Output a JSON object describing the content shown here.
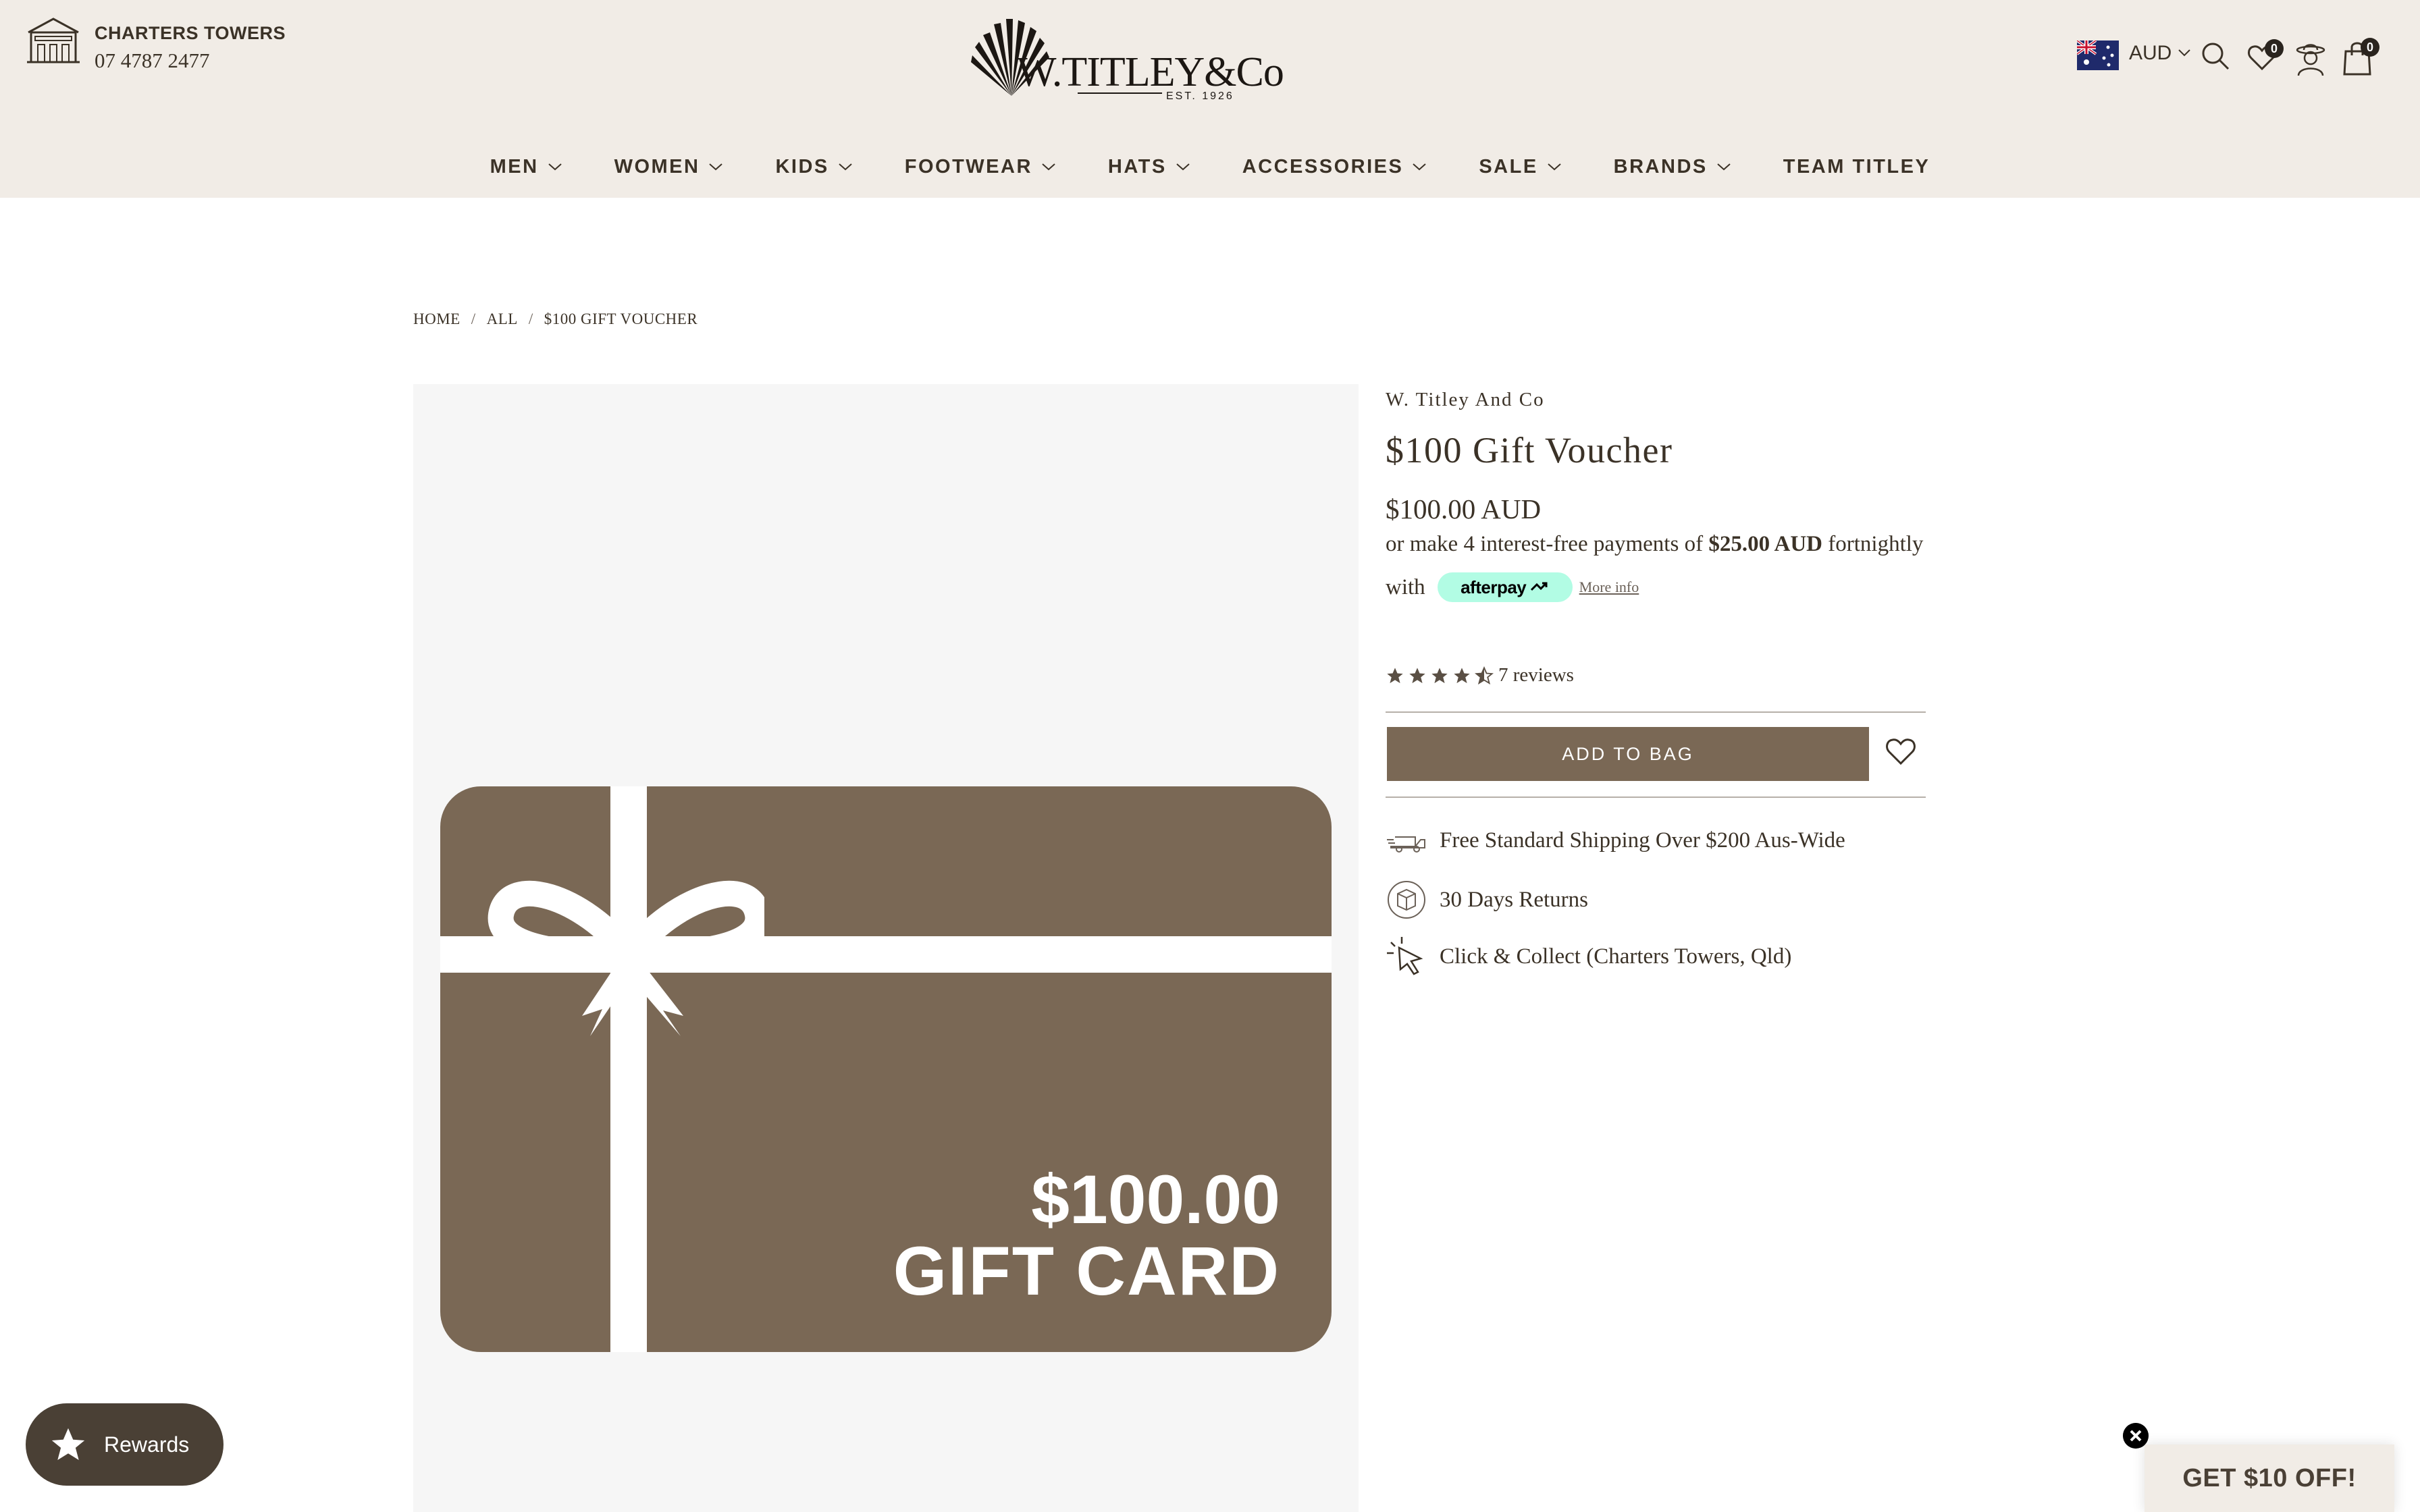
{
  "header": {
    "store_name": "CHARTERS TOWERS",
    "store_phone": "07 4787 2477",
    "logo": {
      "text": "W.TITLEY&Co",
      "est": "EST. 1926"
    },
    "currency": "AUD",
    "wishlist_count": "0",
    "bag_count": "0",
    "icons": [
      "store-icon",
      "australia-flag-icon",
      "chevron-down-icon",
      "search-icon",
      "wishlist-heart-icon",
      "account-icon",
      "bag-icon"
    ]
  },
  "nav": {
    "items": [
      {
        "label": "MEN",
        "has_dropdown": true
      },
      {
        "label": "WOMEN",
        "has_dropdown": true
      },
      {
        "label": "KIDS",
        "has_dropdown": true
      },
      {
        "label": "FOOTWEAR",
        "has_dropdown": true
      },
      {
        "label": "HATS",
        "has_dropdown": true
      },
      {
        "label": "ACCESSORIES",
        "has_dropdown": true
      },
      {
        "label": "SALE",
        "has_dropdown": true
      },
      {
        "label": "BRANDS",
        "has_dropdown": true
      },
      {
        "label": "TEAM TITLEY",
        "has_dropdown": false
      }
    ]
  },
  "breadcrumb": {
    "items": [
      "HOME",
      "ALL",
      "$100 GIFT VOUCHER"
    ],
    "separator": "/"
  },
  "product": {
    "vendor": "W. Titley And Co",
    "title": "$100 Gift Voucher",
    "price": "$100.00 AUD",
    "afterpay": {
      "prefix": "or make 4 interest-free payments of",
      "amount": "$25.00 AUD",
      "suffix": "fortnightly",
      "with": "with",
      "badge": "afterpay",
      "more_info": "More info"
    },
    "rating": {
      "value": 4.5,
      "max": 5,
      "reviews": "7 reviews"
    },
    "add_to_bag": "ADD TO BAG",
    "image": {
      "amount": "$100.00",
      "caption": "GIFT CARD"
    },
    "usps": [
      {
        "icon": "delivery-truck-icon",
        "text": "Free Standard Shipping Over $200 Aus-Wide"
      },
      {
        "icon": "returns-box-icon",
        "text": "30 Days Returns"
      },
      {
        "icon": "click-cursor-icon",
        "text": "Click & Collect (Charters Towers, Qld)"
      }
    ]
  },
  "rewards": {
    "label": "Rewards"
  },
  "discount": {
    "label": "GET $10 OFF!"
  },
  "colors": {
    "header_bg": "#f1ece6",
    "brand_brown": "#7a6855",
    "text_dark": "#3b3227",
    "afterpay_mint": "#b2fce4",
    "rewards_bg": "#4a4035"
  }
}
